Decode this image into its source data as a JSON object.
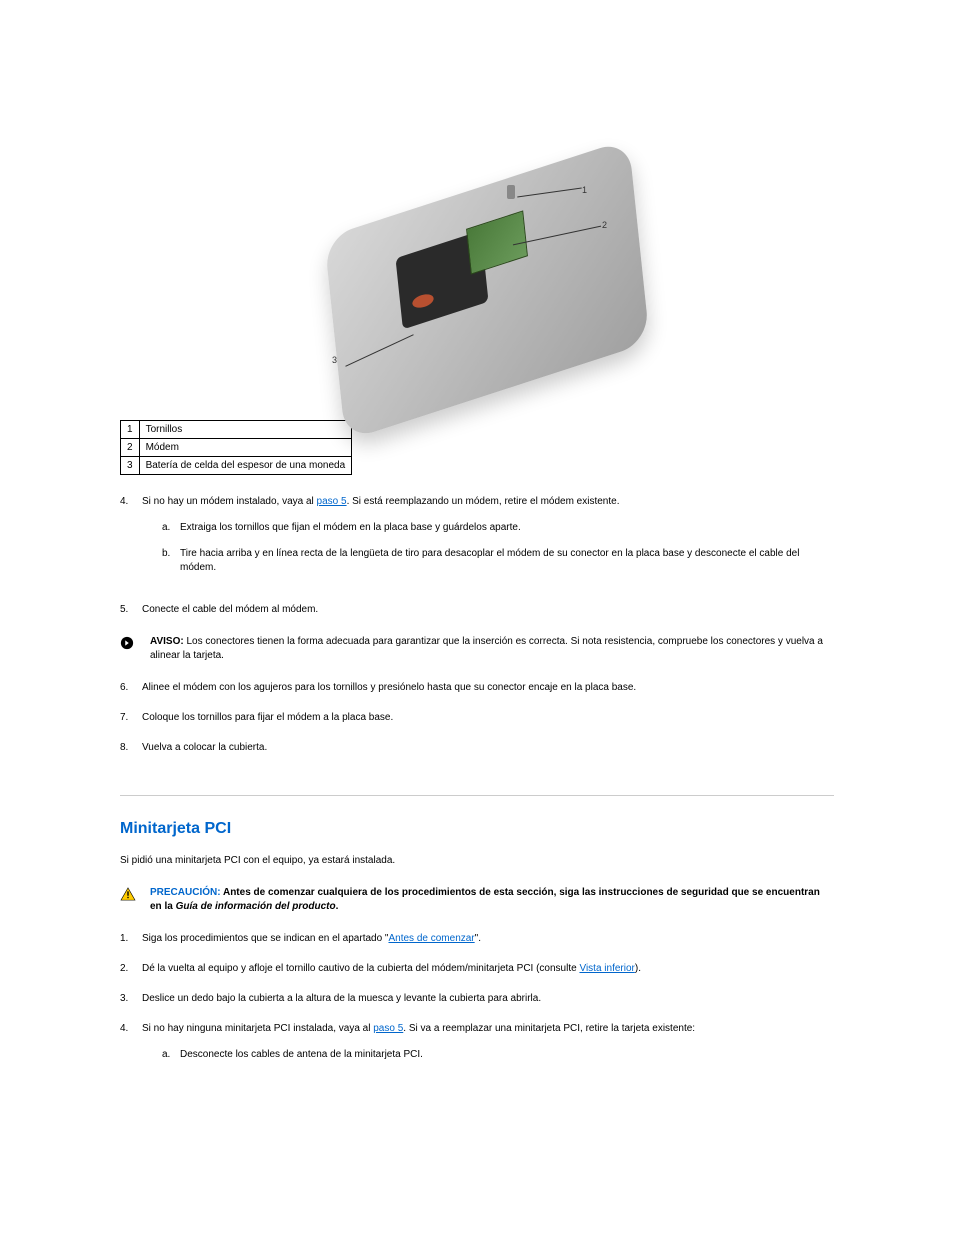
{
  "figure": {
    "callouts": {
      "c1": "1",
      "c2": "2",
      "c3": "3"
    }
  },
  "table": {
    "rows": [
      {
        "num": "1",
        "label": "Tornillos"
      },
      {
        "num": "2",
        "label": "Módem"
      },
      {
        "num": "3",
        "label": "Batería de celda del espesor de una moneda"
      }
    ]
  },
  "steps": {
    "s4": {
      "num": "4.",
      "prefix": "Si no hay un módem instalado, vaya al ",
      "link": "paso 5",
      "suffix": ". Si está reemplazando un módem, retire el módem existente."
    },
    "s4a": {
      "marker": "a.",
      "text": "Extraiga los tornillos que fijan el módem en la placa base y guárdelos aparte."
    },
    "s4b": {
      "marker": "b.",
      "text": "Tire hacia arriba y en línea recta de la lengüeta de tiro para desacoplar el módem de su conector en la placa base y desconecte el cable del módem."
    },
    "s5": {
      "num": "5.",
      "text": "Conecte el cable del módem al módem."
    },
    "s6": {
      "num": "6.",
      "text": "Alinee el módem con los agujeros para los tornillos y presiónelo hasta que su conector encaje en la placa base."
    },
    "s7": {
      "num": "7.",
      "text": "Coloque los tornillos para fijar el módem a la placa base."
    },
    "s8": {
      "num": "8.",
      "text": "Vuelva a colocar la cubierta."
    }
  },
  "aviso": {
    "label": "AVISO:",
    "body": " Los conectores tienen la forma adecuada para garantizar que la inserción es correcta. Si nota resistencia, compruebe los conectores y vuelva a alinear la tarjeta."
  },
  "section": {
    "title": "Minitarjeta PCI",
    "intro": "Si pidió una minitarjeta PCI con el equipo, ya estará instalada."
  },
  "caution": {
    "label": "PRECAUCIÓN: ",
    "body1": "Antes de comenzar cualquiera de los procedimientos de esta sección, siga las instrucciones de seguridad que se encuentran en la ",
    "guide": "Guía de información del producto",
    "body2": "."
  },
  "pci_steps": {
    "s1": {
      "num": "1.",
      "prefix": "Siga los procedimientos que se indican en el apartado \"",
      "link": "Antes de comenzar",
      "suffix": "\"."
    },
    "s2": {
      "num": "2.",
      "prefix": "Dé la vuelta al equipo y afloje el tornillo cautivo de la cubierta del módem/minitarjeta PCI (consulte ",
      "link": "Vista inferior",
      "suffix": ")."
    },
    "s3": {
      "num": "3.",
      "text": "Deslice un dedo bajo la cubierta a la altura de la muesca y levante la cubierta para abrirla."
    },
    "s4": {
      "num": "4.",
      "text": "Si no hay ninguna minitarjeta PCI instalada, vaya al ",
      "link": "paso 5",
      "suffix": ". Si va a reemplazar una minitarjeta PCI, retire la tarjeta existente:"
    },
    "s4a": {
      "marker": "a.",
      "text": "Desconecte los cables de antena de la minitarjeta PCI."
    }
  }
}
